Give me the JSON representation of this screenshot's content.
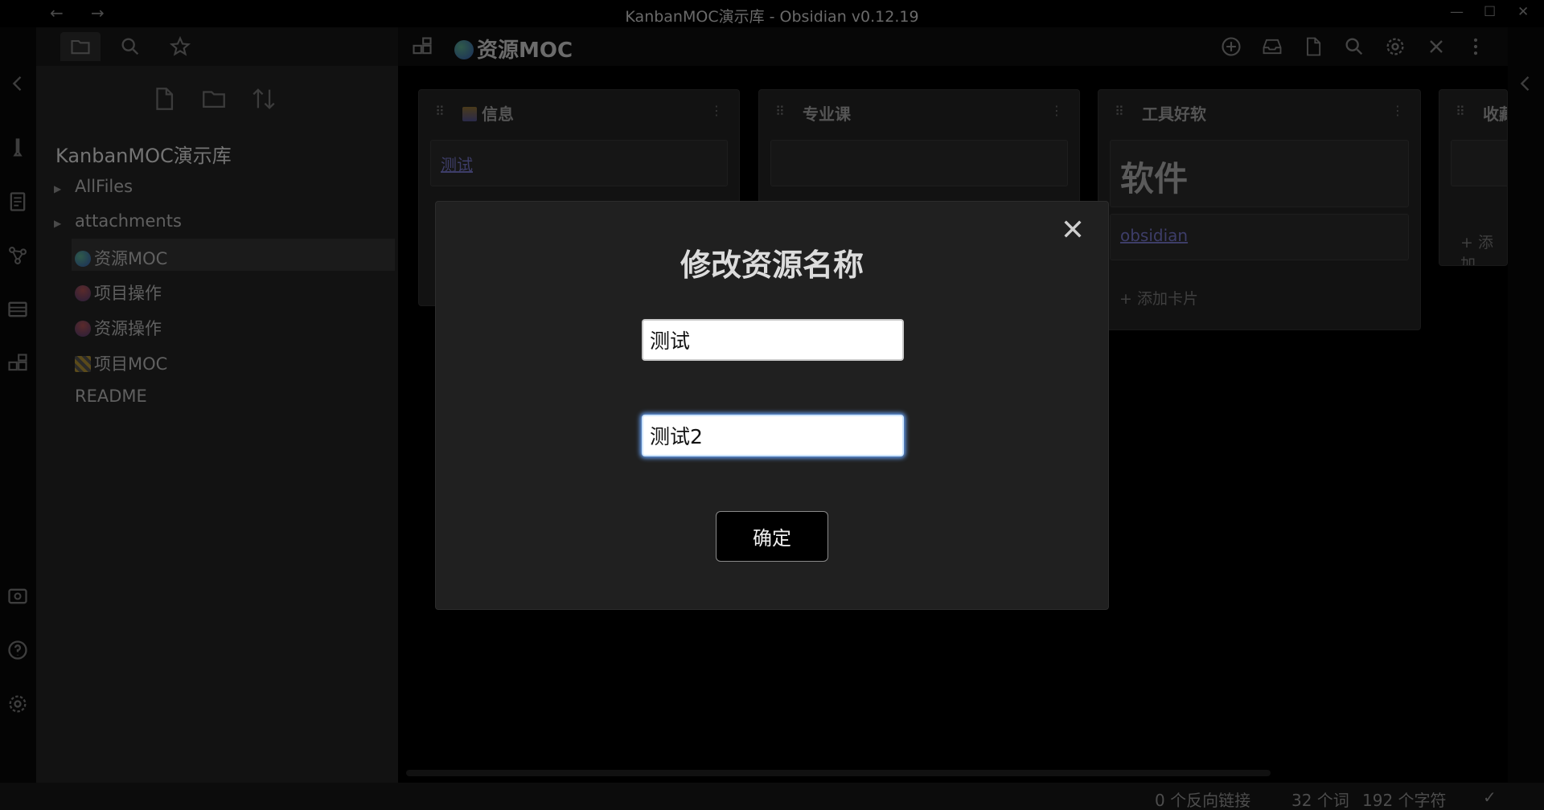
{
  "window": {
    "title": "KanbanMOC演示库 - Obsidian v0.12.19",
    "back_arrow": "←",
    "forward_arrow": "→",
    "minimize": "—",
    "maximize": "☐",
    "close": "✕"
  },
  "sidebar": {
    "vault_name": "KanbanMOC演示库",
    "tree": [
      {
        "label": "AllFiles",
        "kind": "folder",
        "icon": "caret-right-icon"
      },
      {
        "label": "attachments",
        "kind": "folder",
        "icon": "caret-right-icon"
      },
      {
        "label": "资源MOC",
        "kind": "file",
        "icon": "globe-emoji",
        "active": true
      },
      {
        "label": "项目操作",
        "kind": "file",
        "icon": "joystick-emoji"
      },
      {
        "label": "资源操作",
        "kind": "file",
        "icon": "joystick-emoji"
      },
      {
        "label": "项目MOC",
        "kind": "file",
        "icon": "construction-emoji"
      },
      {
        "label": "README",
        "kind": "file",
        "icon": ""
      }
    ]
  },
  "main": {
    "view_title": "资源MOC",
    "lanes": [
      {
        "title": "信息",
        "cards": [
          "测试"
        ],
        "add_label": ""
      },
      {
        "title": "专业课",
        "cards": [],
        "add_label": ""
      },
      {
        "title": "工具好软",
        "cards": [
          "软件",
          "obsidian"
        ],
        "add_label": "+ 添加卡片"
      },
      {
        "title": "收藏",
        "cards": [],
        "add_label": "+ 添加"
      }
    ]
  },
  "modal": {
    "title": "修改资源名称",
    "input_old": "测试",
    "input_new": "测试2",
    "confirm": "确定",
    "close_glyph": "✕"
  },
  "status": {
    "backlinks": "0 个反向链接",
    "words": "32 个词",
    "chars": "192 个字符",
    "sync_check": "✓"
  },
  "colors": {
    "accent_focus": "#6aa7ff",
    "modal_bg": "#202020",
    "overlay_bg": "#000000"
  }
}
